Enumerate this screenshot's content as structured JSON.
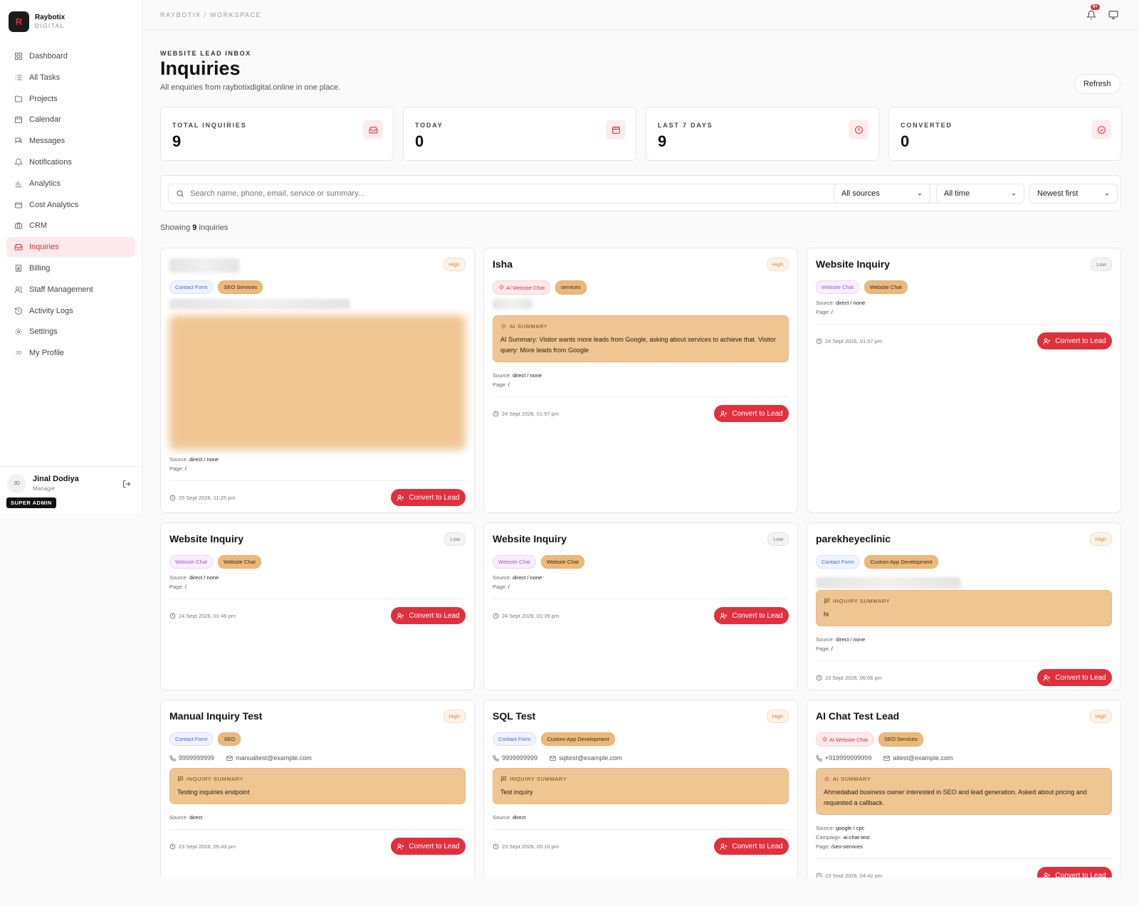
{
  "brand": {
    "name": "Raybotix",
    "sub": "DIGITAL",
    "logo_letter": "R",
    "accent": "#e0303e"
  },
  "sidebar": {
    "items": [
      {
        "label": "Dashboard",
        "icon": "grid-icon",
        "name": "sidebar-item-dashboard"
      },
      {
        "label": "All Tasks",
        "icon": "list-icon",
        "name": "sidebar-item-all-tasks"
      },
      {
        "label": "Projects",
        "icon": "folder-icon",
        "name": "sidebar-item-projects"
      },
      {
        "label": "Calendar",
        "icon": "calendar-icon",
        "name": "sidebar-item-calendar"
      },
      {
        "label": "Messages",
        "icon": "messages-icon",
        "name": "sidebar-item-messages"
      },
      {
        "label": "Notifications",
        "icon": "bell-icon",
        "name": "sidebar-item-notifications"
      },
      {
        "label": "Analytics",
        "icon": "bar-chart-icon",
        "name": "sidebar-item-analytics"
      },
      {
        "label": "Cost Analytics",
        "icon": "wallet-icon",
        "name": "sidebar-item-cost-analytics"
      },
      {
        "label": "CRM",
        "icon": "briefcase-icon",
        "name": "sidebar-item-crm"
      },
      {
        "label": "Inquiries",
        "icon": "inbox-icon",
        "name": "sidebar-item-inquiries",
        "active": true
      },
      {
        "label": "Billing",
        "icon": "receipt-icon",
        "name": "sidebar-item-billing"
      },
      {
        "label": "Staff Management",
        "icon": "users-icon",
        "name": "sidebar-item-staff-management"
      },
      {
        "label": "Activity Logs",
        "icon": "history-icon",
        "name": "sidebar-item-activity-logs"
      },
      {
        "label": "Settings",
        "icon": "gear-icon",
        "name": "sidebar-item-settings"
      },
      {
        "label": "My Profile",
        "icon": "profile-initials-icon",
        "name": "sidebar-item-my-profile",
        "initials": "JD"
      }
    ]
  },
  "user": {
    "initials": "JD",
    "name": "Jinal Dodiya",
    "role": "Manager",
    "badge": "SUPER ADMIN"
  },
  "topbar": {
    "breadcrumb": "RAYBOTIX / WORKSPACE",
    "notif_count": "9+"
  },
  "page": {
    "eyebrow": "WEBSITE LEAD INBOX",
    "title": "Inquiries",
    "subtitle": "All enquiries from raybotixdigital.online in one place.",
    "refresh_label": "Refresh"
  },
  "stats": [
    {
      "label": "TOTAL INQUIRIES",
      "value": "9",
      "icon": "inbox-icon"
    },
    {
      "label": "TODAY",
      "value": "0",
      "icon": "calendar-icon"
    },
    {
      "label": "LAST 7 DAYS",
      "value": "9",
      "icon": "clock-icon"
    },
    {
      "label": "CONVERTED",
      "value": "0",
      "icon": "check-circle-icon"
    }
  ],
  "filters": {
    "search_placeholder": "Search name, phone, email, service or summary...",
    "source": "All sources",
    "time": "All time",
    "sort": "Newest first"
  },
  "showing": {
    "prefix": "Showing",
    "count": "9",
    "suffix": "inquiries"
  },
  "convert_label": "Convert to Lead",
  "cards": [
    {
      "name": "",
      "priority": "High",
      "tags": [
        {
          "label": "Contact Form",
          "kind": "form"
        },
        {
          "label": "SEO Services",
          "kind": "svc"
        }
      ],
      "blurred": true,
      "source": "direct / none",
      "page": "/",
      "date": "25 Sept 2026, 11:25 pm"
    },
    {
      "name": "Isha",
      "priority": "High",
      "tags": [
        {
          "label": "AI Website Chat",
          "kind": "ai"
        },
        {
          "label": "services",
          "kind": "svc"
        }
      ],
      "summary_title": "AI SUMMARY",
      "summary_kind": "ai",
      "summary": "AI Summary: Visitor wants more leads from Google, asking about services to achieve that. Visitor query: More leads from Google",
      "source": "direct / none",
      "page": "/",
      "date": "24 Sept 2026, 01:57 pm"
    },
    {
      "name": "Website Inquiry",
      "priority": "Low",
      "tags": [
        {
          "label": "Website Chat",
          "kind": "chat"
        },
        {
          "label": "Website Chat",
          "kind": "svc"
        }
      ],
      "source": "direct / none",
      "page": "/",
      "date": "24 Sept 2026, 01:57 pm"
    },
    {
      "name": "Website Inquiry",
      "priority": "Low",
      "tags": [
        {
          "label": "Website Chat",
          "kind": "chat"
        },
        {
          "label": "Website Chat",
          "kind": "svc"
        }
      ],
      "source": "direct / none",
      "page": "/",
      "date": "24 Sept 2026, 01:46 pm"
    },
    {
      "name": "Website Inquiry",
      "priority": "Low",
      "tags": [
        {
          "label": "Website Chat",
          "kind": "chat"
        },
        {
          "label": "Website Chat",
          "kind": "svc"
        }
      ],
      "source": "direct / none",
      "page": "/",
      "date": "24 Sept 2026, 01:35 pm"
    },
    {
      "name": "parekheyeclinic",
      "priority": "High",
      "tags": [
        {
          "label": "Contact Form",
          "kind": "form"
        },
        {
          "label": "Custom App Development",
          "kind": "svc"
        }
      ],
      "summary_title": "INQUIRY SUMMARY",
      "summary_kind": "inquiry",
      "summary": "hi",
      "source": "direct / none",
      "page": "/",
      "date": "23 Sept 2026, 06:06 pm"
    },
    {
      "name": "Manual Inquiry Test",
      "priority": "High",
      "tags": [
        {
          "label": "Contact Form",
          "kind": "form"
        },
        {
          "label": "SEO",
          "kind": "svc"
        }
      ],
      "phone": "9999999999",
      "email": "manualtest@example.com",
      "summary_title": "INQUIRY SUMMARY",
      "summary_kind": "inquiry",
      "summary": "Testing inquiries endpoint",
      "source": "direct",
      "date": "23 Sept 2026, 05:43 pm"
    },
    {
      "name": "SQL Test",
      "priority": "High",
      "tags": [
        {
          "label": "Contact Form",
          "kind": "form"
        },
        {
          "label": "Custom App Development",
          "kind": "svc"
        }
      ],
      "phone": "9999999999",
      "email": "sqltest@example.com",
      "summary_title": "INQUIRY SUMMARY",
      "summary_kind": "inquiry",
      "summary": "Test inquiry",
      "source": "direct",
      "date": "23 Sept 2026, 05:10 pm"
    },
    {
      "name": "AI Chat Test Lead",
      "priority": "High",
      "tags": [
        {
          "label": "AI Website Chat",
          "kind": "ai"
        },
        {
          "label": "SEO Services",
          "kind": "svc"
        }
      ],
      "phone": "+919999999999",
      "email": "aitest@example.com",
      "summary_title": "AI SUMMARY",
      "summary_kind": "ai",
      "summary": "Ahmedabad business owner interested in SEO and lead generation. Asked about pricing and requested a callback.",
      "source": "google / cpc",
      "campaign": "ai-chat-test",
      "page": "/seo-services",
      "date": "23 Sept 2026, 04:42 pm"
    }
  ]
}
